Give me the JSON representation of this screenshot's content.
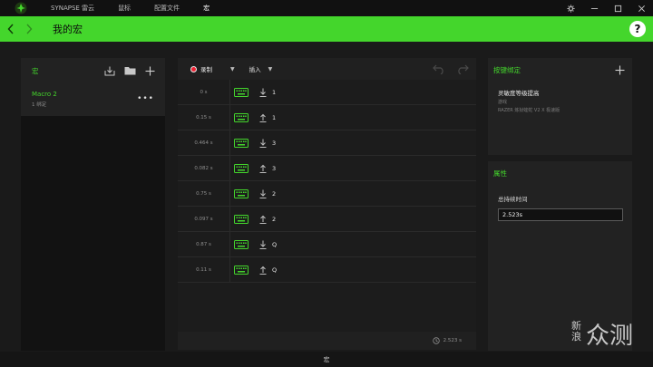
{
  "titlebar": {
    "tabs": [
      {
        "label": "SYNAPSE 雷云",
        "active": false
      },
      {
        "label": "鼠标",
        "active": false
      },
      {
        "label": "配置文件",
        "active": false
      },
      {
        "label": "宏",
        "active": true
      }
    ],
    "controls": [
      "gear-icon",
      "minimize-icon",
      "maximize-icon",
      "close-icon"
    ]
  },
  "header": {
    "title": "我的宏",
    "help": "?",
    "accent": "#44d62c"
  },
  "left_panel": {
    "title": "宏",
    "icons": [
      "import-icon",
      "folder-icon",
      "plus-icon"
    ],
    "macros": [
      {
        "name": "Macro 2",
        "sub": "1 绑定",
        "menu": "•••"
      }
    ]
  },
  "center_panel": {
    "record_label": "录制",
    "insert_label": "插入",
    "rows": [
      {
        "time": "0 s",
        "direction": "down",
        "key": "1"
      },
      {
        "time": "0.15 s",
        "direction": "up",
        "key": "1"
      },
      {
        "time": "0.464 s",
        "direction": "down",
        "key": "3"
      },
      {
        "time": "0.082 s",
        "direction": "up",
        "key": "3"
      },
      {
        "time": "0.75 s",
        "direction": "down",
        "key": "2"
      },
      {
        "time": "0.097 s",
        "direction": "up",
        "key": "2"
      },
      {
        "time": "0.87 s",
        "direction": "down",
        "key": "Q"
      },
      {
        "time": "0.11 s",
        "direction": "up",
        "key": "Q"
      }
    ],
    "total_time": "2.523 s"
  },
  "binding_panel": {
    "title": "按键绑定",
    "binding_name": "灵敏度等级提高",
    "binding_line2": "游戏",
    "binding_line3": "RAZER 炼狱蝰蛇 V2 X 极速版"
  },
  "props_panel": {
    "title": "属性",
    "label": "总持续时间",
    "value": "2.523s"
  },
  "statusbar": {
    "label": "宏"
  },
  "watermark": {
    "top": "新浪",
    "main": "众测"
  }
}
